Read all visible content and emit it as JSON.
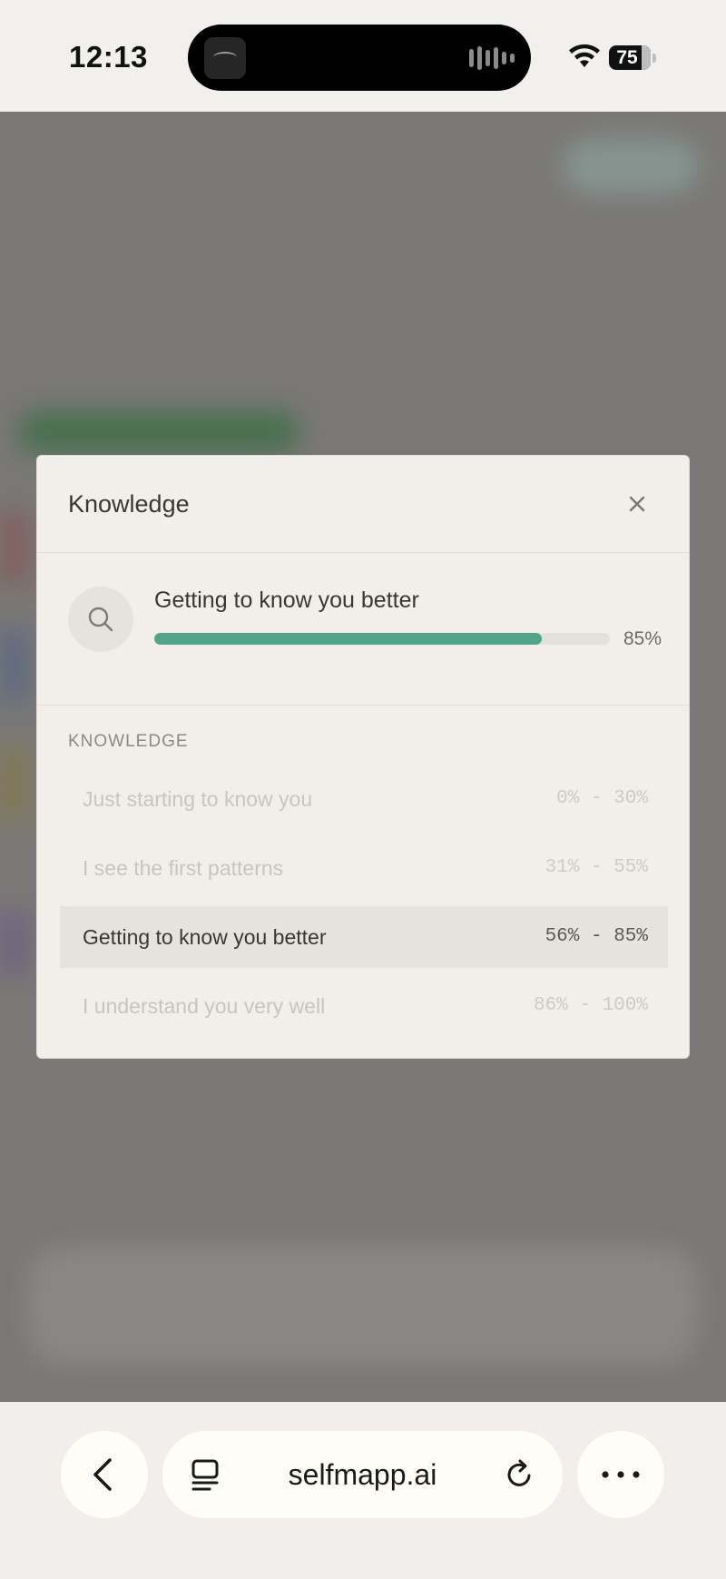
{
  "status_bar": {
    "time": "12:13",
    "battery_level": "75",
    "icons": [
      "wifi-icon",
      "battery-icon"
    ]
  },
  "modal": {
    "title": "Knowledge",
    "close_icon": "close-icon",
    "progress": {
      "icon": "search-icon",
      "title": "Getting to know you better",
      "percent_label": "85%",
      "percent_value": 85,
      "fill_color": "#4fa48a"
    },
    "levels_heading": "KNOWLEDGE",
    "levels": [
      {
        "label": "Just starting to know you",
        "range": "0% - 30%",
        "active": false
      },
      {
        "label": "I see the first patterns",
        "range": "31% - 55%",
        "active": false
      },
      {
        "label": "Getting to know you better",
        "range": "56% - 85%",
        "active": true
      },
      {
        "label": "I understand you very well",
        "range": "86% - 100%",
        "active": false
      }
    ]
  },
  "browser": {
    "url": "selfmapp.ai",
    "icons": [
      "back-icon",
      "tabs-icon",
      "reload-icon",
      "more-icon"
    ]
  }
}
